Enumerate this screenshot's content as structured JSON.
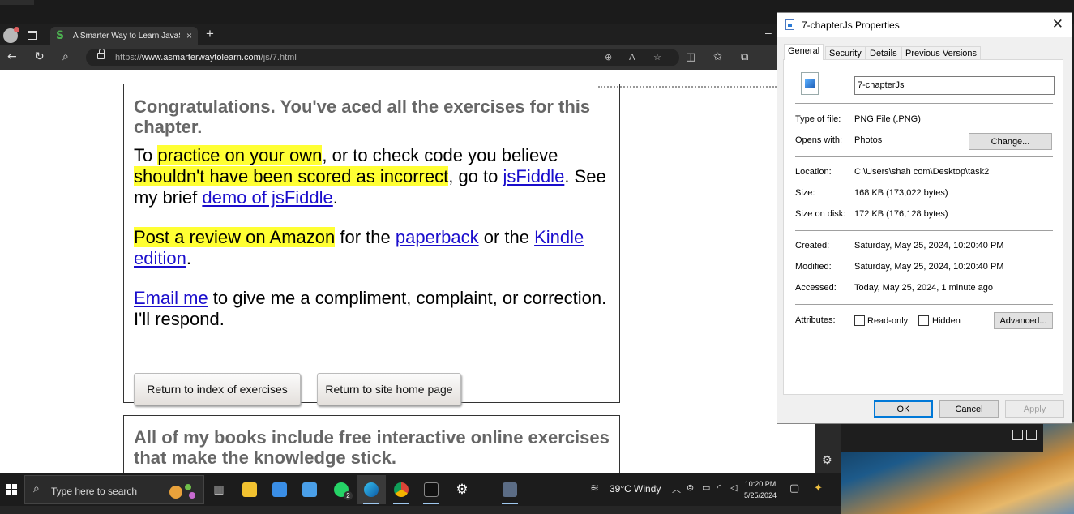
{
  "browser": {
    "tab_title": "A Smarter Way to Learn JavaScrip",
    "tab_favicon": "S",
    "tab_close": "×",
    "new_tab": "+",
    "minimize": "–",
    "url_scheme": "https://",
    "url_host": "www.asmarterwaytolearn.com",
    "url_path": "/js/7.html",
    "back": "←",
    "refresh": "↻",
    "search": "⌕"
  },
  "page": {
    "congrats": "Congratulations. You've aced all the exercises for this chapter.",
    "p1_a": "To ",
    "p1_hl1": "practice on your own",
    "p1_b": ", or to check code you believe ",
    "p1_hl2": "shouldn't have been scored as incorrect",
    "p1_c": ", go to ",
    "p1_link1": "jsFiddle",
    "p1_d": ". See my brief ",
    "p1_link2": "demo of jsFiddle",
    "p1_e": ".",
    "p2_hl": "Post a review on Amazon",
    "p2_a": " for the ",
    "p2_link1": "paperback",
    "p2_b": " or the ",
    "p2_link2": "Kindle edition",
    "p2_c": ".",
    "p3_link": "Email me",
    "p3_a": " to give me a compliment, complaint, or correction. I'll respond.",
    "btn_index": "Return to index of exercises",
    "btn_home": "Return to site home page",
    "box2_text": "All of my books include free interactive online exercises that make the knowledge stick."
  },
  "dialog": {
    "title": "7-chapterJs Properties",
    "close": "✕",
    "tabs": [
      "General",
      "Security",
      "Details",
      "Previous Versions"
    ],
    "file_name": "7-chapterJs",
    "type_label": "Type of file:",
    "type_value": "PNG File (.PNG)",
    "opens_label": "Opens with:",
    "opens_value": "Photos",
    "change_btn": "Change...",
    "location_label": "Location:",
    "location_value": "C:\\Users\\shah com\\Desktop\\task2",
    "size_label": "Size:",
    "size_value": "168 KB (173,022 bytes)",
    "disk_label": "Size on disk:",
    "disk_value": "172 KB (176,128 bytes)",
    "created_label": "Created:",
    "created_value": "Saturday, May 25, 2024, 10:20:40 PM",
    "modified_label": "Modified:",
    "modified_value": "Saturday, May 25, 2024, 10:20:40 PM",
    "accessed_label": "Accessed:",
    "accessed_value": "Today, May 25, 2024, 1 minute ago",
    "attr_label": "Attributes:",
    "readonly": "Read-only",
    "hidden": "Hidden",
    "advanced_btn": "Advanced...",
    "ok": "OK",
    "cancel": "Cancel",
    "apply": "Apply"
  },
  "taskbar": {
    "search_placeholder": "Type here to search",
    "weather_temp": "39°C",
    "weather_text": "Windy",
    "time": "10:20 PM",
    "date": "5/25/2024",
    "whatsapp_badge": "2"
  },
  "colors": {
    "highlight": "#ffff33",
    "link": "#1a0dcc",
    "accent": "#0078d7"
  }
}
